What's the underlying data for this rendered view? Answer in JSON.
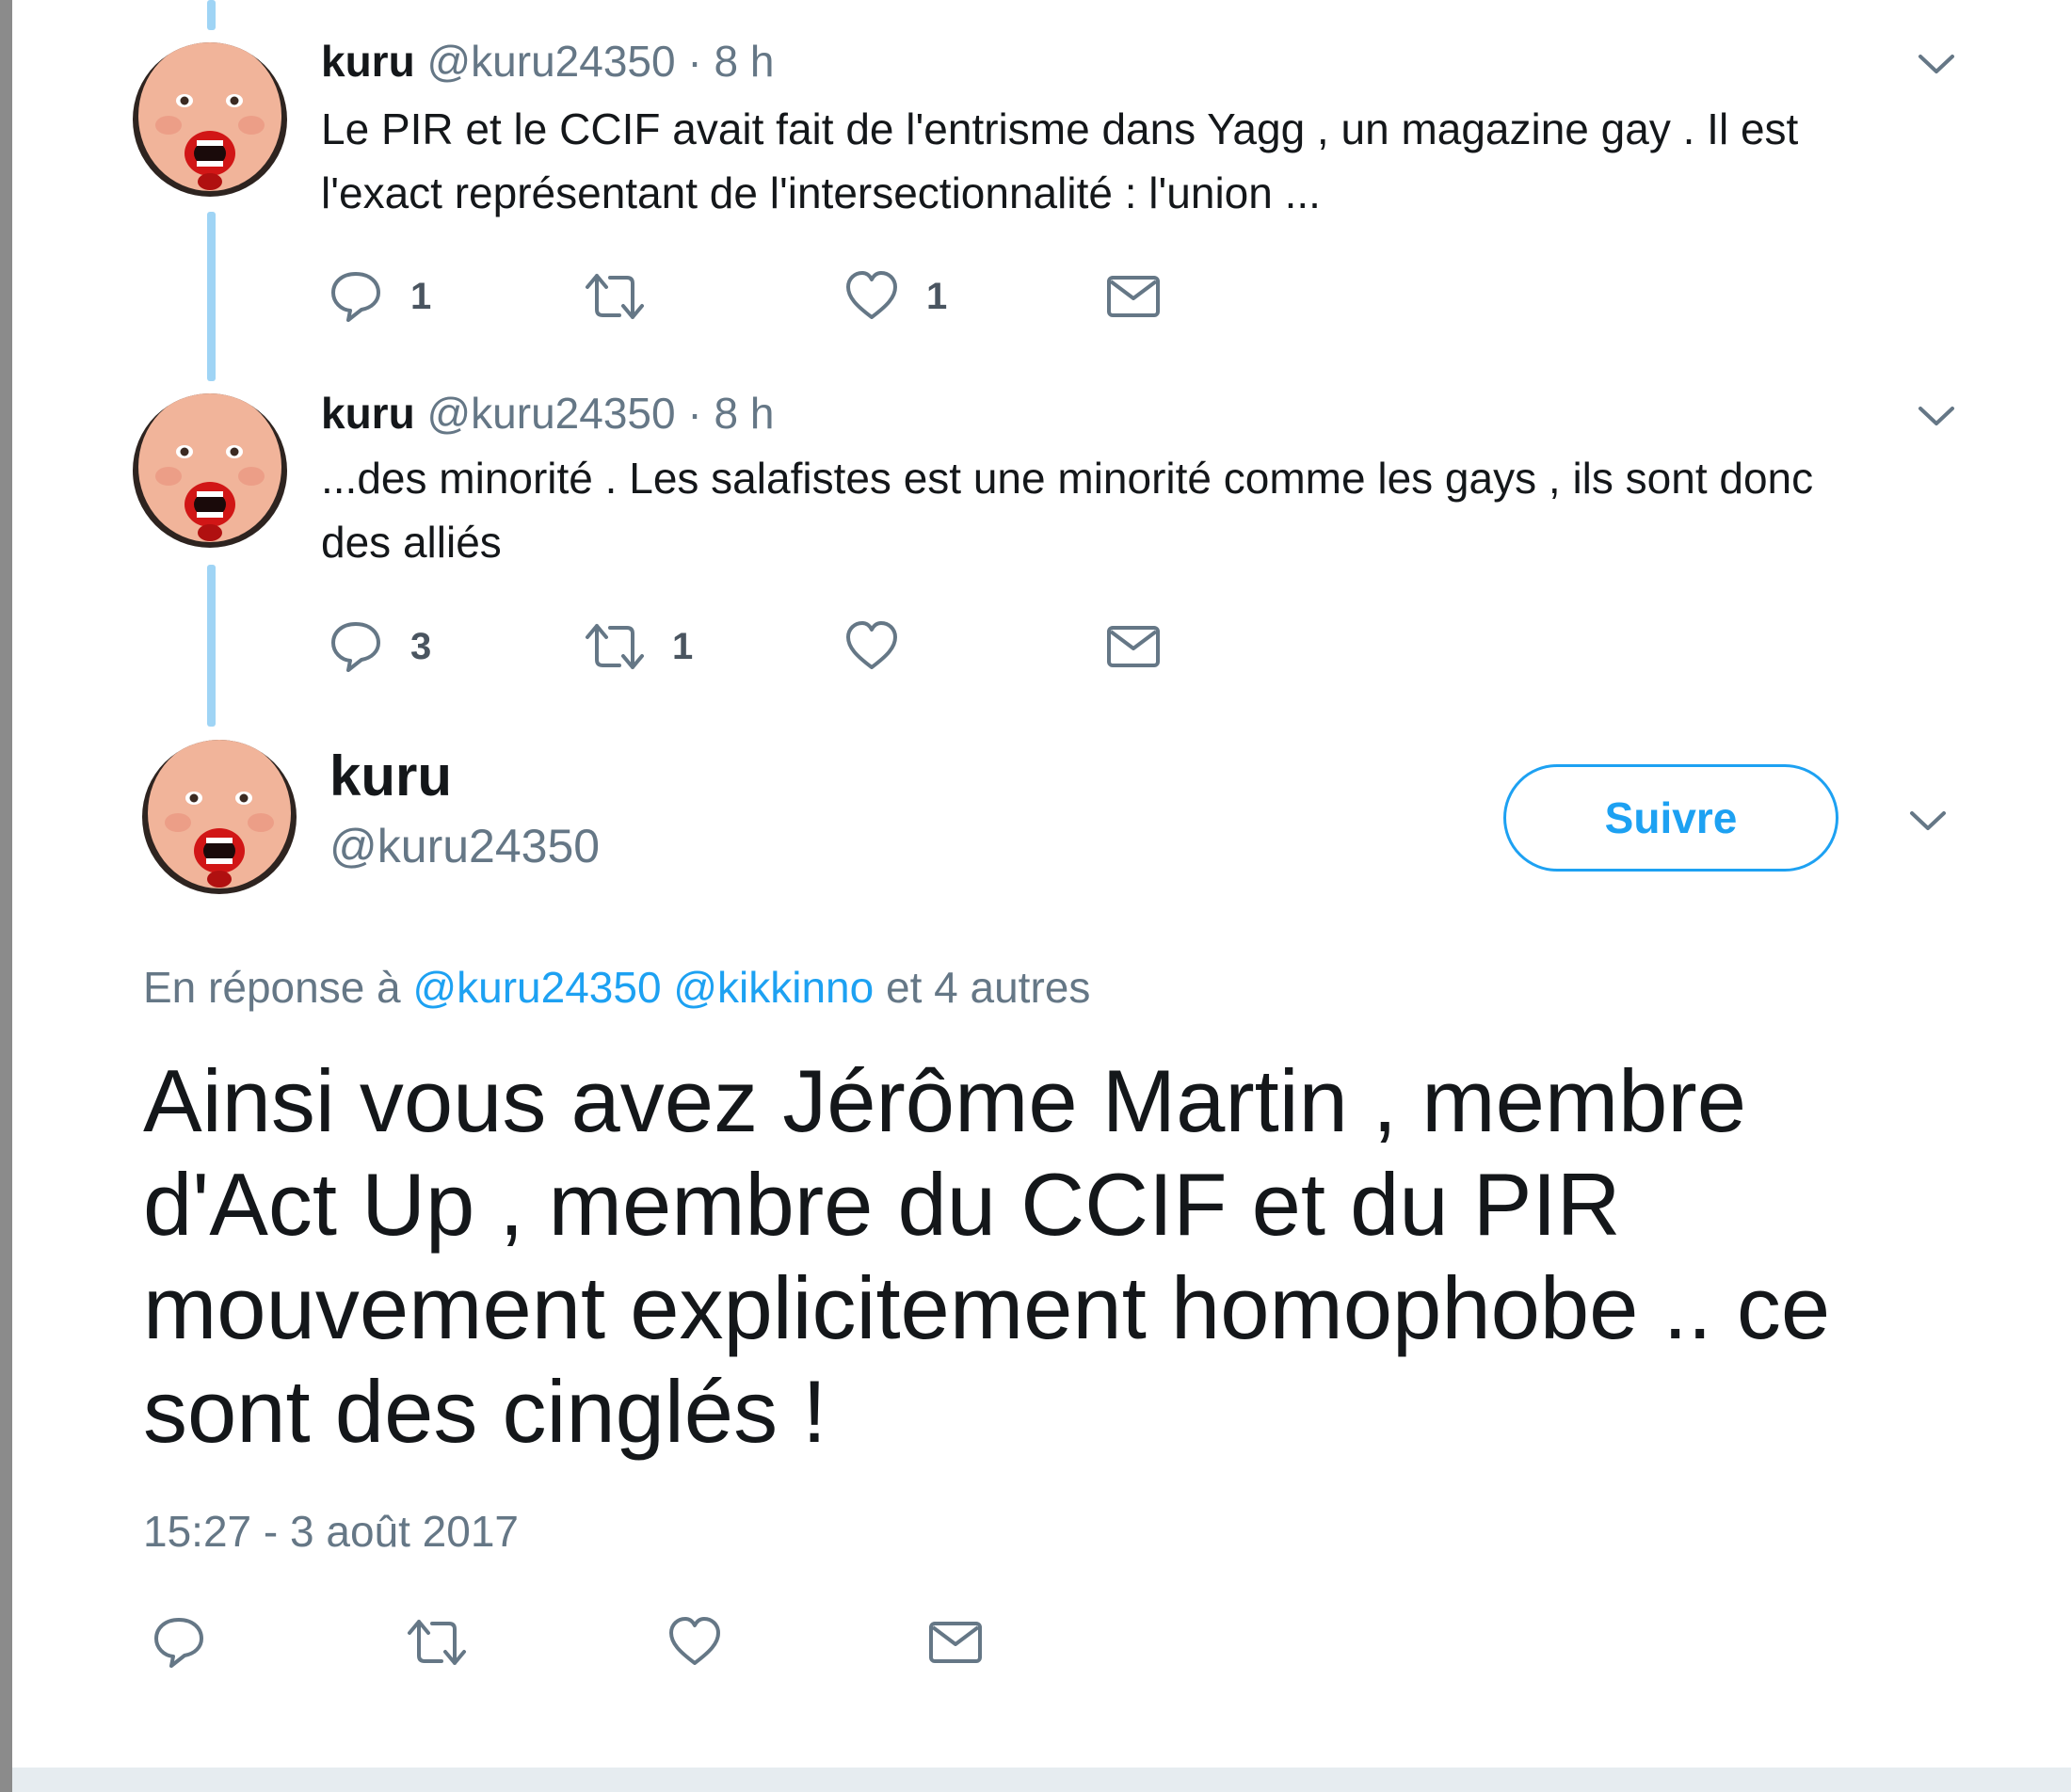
{
  "thread": [
    {
      "name": "kuru",
      "handle": "@kuru24350",
      "separator": "·",
      "time": "8 h",
      "text_line1": "Le PIR et le CCIF avait fait de l'entrisme dans Yagg , un magazine gay . Il est",
      "text_line2": "l'exact représentant de l'intersectionnalité : l'union ...",
      "replies": "1",
      "retweets": "",
      "likes": "1"
    },
    {
      "name": "kuru",
      "handle": "@kuru24350",
      "separator": "·",
      "time": "8 h",
      "text_line1": "...des minorité . Les salafistes est une minorité comme les gays , ils sont donc",
      "text_line2": "des alliés",
      "replies": "3",
      "retweets": "1",
      "likes": ""
    }
  ],
  "main_tweet": {
    "name": "kuru",
    "handle": "@kuru24350",
    "follow_label": "Suivre",
    "reply_prefix": "En réponse à",
    "reply_mention1": "@kuru24350",
    "reply_mention2": "@kikkinno",
    "reply_suffix": "et 4 autres",
    "text_line1": "Ainsi vous avez Jérôme Martin , membre",
    "text_line2": "d'Act Up , membre du CCIF et du PIR",
    "text_line3": "mouvement explicitement homophobe .. ce",
    "text_line4": "sont des cinglés !",
    "timestamp": "15:27 - 3 août 2017"
  },
  "icons": {
    "reply": "reply-icon",
    "retweet": "retweet-icon",
    "like": "heart-icon",
    "message": "envelope-icon",
    "more": "chevron-down-icon"
  },
  "colors": {
    "accent": "#1da1f2",
    "thread_line": "#9fd4f5",
    "secondary_text": "#657786",
    "primary_text": "#14171a"
  }
}
